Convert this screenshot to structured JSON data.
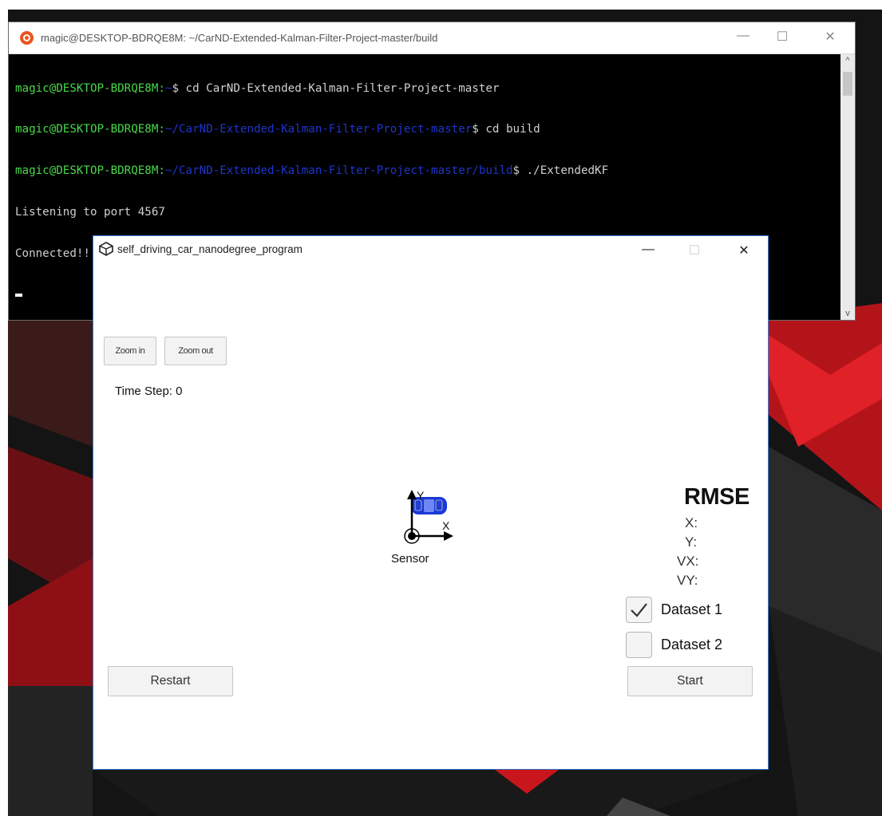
{
  "terminal": {
    "title": "magic@DESKTOP-BDRQE8M: ~/CarND-Extended-Kalman-Filter-Project-master/build",
    "lines": [
      {
        "user": "magic@DESKTOP-BDRQE8M:",
        "path": "~",
        "cmd": "$ cd CarND-Extended-Kalman-Filter-Project-master"
      },
      {
        "user": "magic@DESKTOP-BDRQE8M:",
        "path": "~/CarND-Extended-Kalman-Filter-Project-master",
        "cmd": "$ cd build"
      },
      {
        "user": "magic@DESKTOP-BDRQE8M:",
        "path": "~/CarND-Extended-Kalman-Filter-Project-master/build",
        "cmd": "$ ./ExtendedKF"
      }
    ],
    "output": [
      "Listening to port 4567",
      "Connected!!!"
    ]
  },
  "sim": {
    "title": "self_driving_car_nanodegree_program",
    "zoom_in": "Zoom in",
    "zoom_out": "Zoom out",
    "time_step": "Time Step: 0",
    "sensor_label": "Sensor",
    "axis_x": "X",
    "axis_y": "Y",
    "rmse_title": "RMSE",
    "rmse_labels": [
      "X:",
      "Y:",
      "VX:",
      "VY:"
    ],
    "dataset1": {
      "label": "Dataset 1",
      "checked": true
    },
    "dataset2": {
      "label": "Dataset 2",
      "checked": false
    },
    "restart": "Restart",
    "start": "Start"
  },
  "colors": {
    "accent": "#3a7bd5",
    "terminal_green": "#48d848",
    "terminal_blue": "#1f35c9",
    "wallpaper_red": "#c8161c"
  },
  "window_controls": {
    "minimize": "—",
    "maximize": "☐",
    "close": "✕"
  }
}
